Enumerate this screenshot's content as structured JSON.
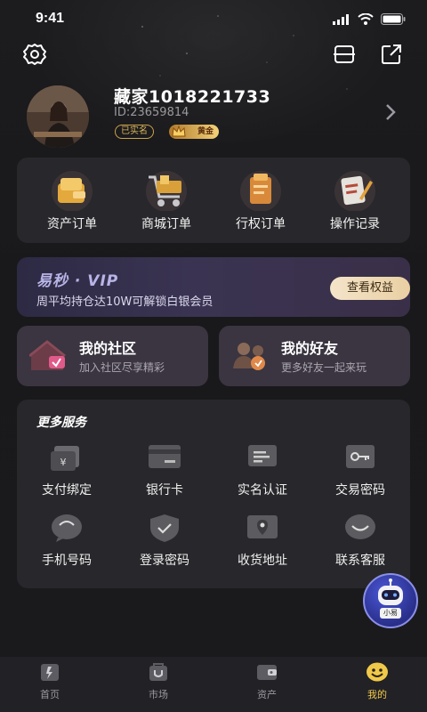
{
  "status": {
    "time": "9:41"
  },
  "profile": {
    "name": "藏家1018221733",
    "uid": "ID:23659814",
    "badge_real": "已实名",
    "badge_gold": "黄金"
  },
  "orders": [
    {
      "label": "资产订单",
      "icon": "asset-wallet-icon"
    },
    {
      "label": "商城订单",
      "icon": "shopping-cart-icon"
    },
    {
      "label": "行权订单",
      "icon": "exercise-book-icon"
    },
    {
      "label": "操作记录",
      "icon": "operation-log-icon"
    }
  ],
  "vip": {
    "title": "易秒 · VIP",
    "desc": "周平均持仓达10W可解锁白银会员",
    "button": "查看权益"
  },
  "social": [
    {
      "title": "我的社区",
      "subtitle": "加入社区尽享精彩",
      "icon": "community-house-icon"
    },
    {
      "title": "我的好友",
      "subtitle": "更多好友一起来玩",
      "icon": "friends-icon"
    }
  ],
  "services": {
    "title": "更多服务",
    "items": [
      {
        "label": "支付绑定",
        "icon": "payment-bind-icon"
      },
      {
        "label": "银行卡",
        "icon": "bank-card-icon"
      },
      {
        "label": "实名认证",
        "icon": "id-verify-icon"
      },
      {
        "label": "交易密码",
        "icon": "trade-password-icon"
      },
      {
        "label": "手机号码",
        "icon": "phone-chat-icon"
      },
      {
        "label": "登录密码",
        "icon": "login-shield-icon"
      },
      {
        "label": "收货地址",
        "icon": "address-pin-icon"
      },
      {
        "label": "联系客服",
        "icon": "customer-service-icon"
      }
    ]
  },
  "assistant": {
    "label": "小易"
  },
  "tabs": [
    {
      "label": "首页",
      "icon": "home-icon",
      "active": false
    },
    {
      "label": "市场",
      "icon": "market-bag-icon",
      "active": false
    },
    {
      "label": "资产",
      "icon": "assets-wallet-icon",
      "active": false
    },
    {
      "label": "我的",
      "icon": "me-face-icon",
      "active": true
    }
  ],
  "colors": {
    "accent": "#f0c94a",
    "card": "#28272b",
    "vip_button": "#f1dcb6",
    "background": "#18181a"
  }
}
